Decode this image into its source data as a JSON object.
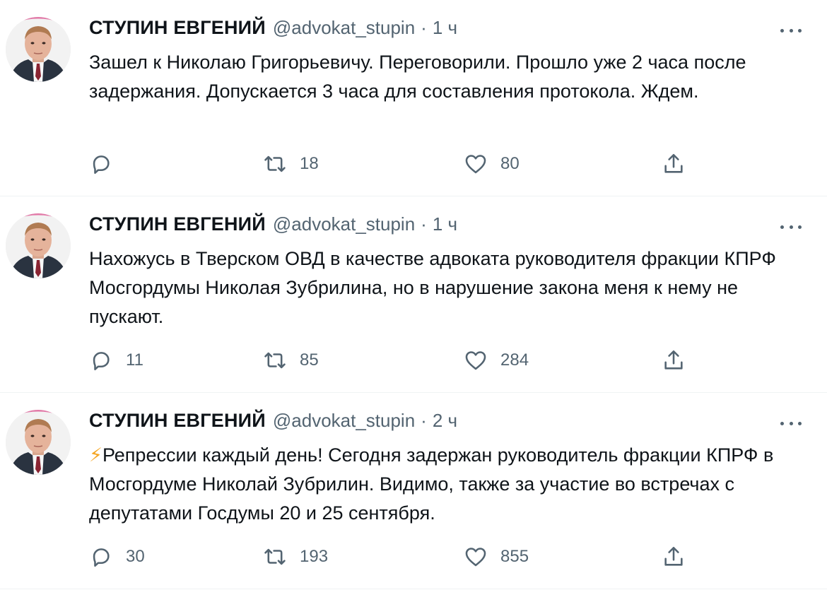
{
  "tweets": [
    {
      "name": "СТУПИН ЕВГЕНИЙ",
      "handle": "@advokat_stupin",
      "separator": "·",
      "time": "1 ч",
      "prefix": "",
      "text": "Зашел к Николаю Григорьевичу. Переговорили. Прошло уже 2 часа после задержания. Допускается 3 часа для составления протокола. Ждем.",
      "replies": "",
      "retweets": "18",
      "likes": "80"
    },
    {
      "name": "СТУПИН ЕВГЕНИЙ",
      "handle": "@advokat_stupin",
      "separator": "·",
      "time": "1 ч",
      "prefix": "",
      "text": "Нахожусь в Тверском ОВД в качестве адвоката руководителя фракции КПРФ Мосгордумы Николая Зубрилина, но в нарушение закона меня к нему не пускают.",
      "replies": "11",
      "retweets": "85",
      "likes": "284"
    },
    {
      "name": "СТУПИН ЕВГЕНИЙ",
      "handle": "@advokat_stupin",
      "separator": "·",
      "time": "2 ч",
      "prefix": "⚡",
      "text": "Репрессии каждый день! Сегодня задержан руководитель фракции КПРФ в Мосгордуме Николай Зубрилин. Видимо, также за участие во встречах с депутатами Госдумы 20 и 25 сентября.",
      "replies": "30",
      "retweets": "193",
      "likes": "855"
    }
  ],
  "icons": {
    "reply": "reply-icon",
    "retweet": "retweet-icon",
    "like": "heart-icon",
    "share": "share-icon",
    "more": "more-icon"
  },
  "colors": {
    "text": "#0f1419",
    "secondary": "#536471",
    "divider": "#eff3f4"
  }
}
